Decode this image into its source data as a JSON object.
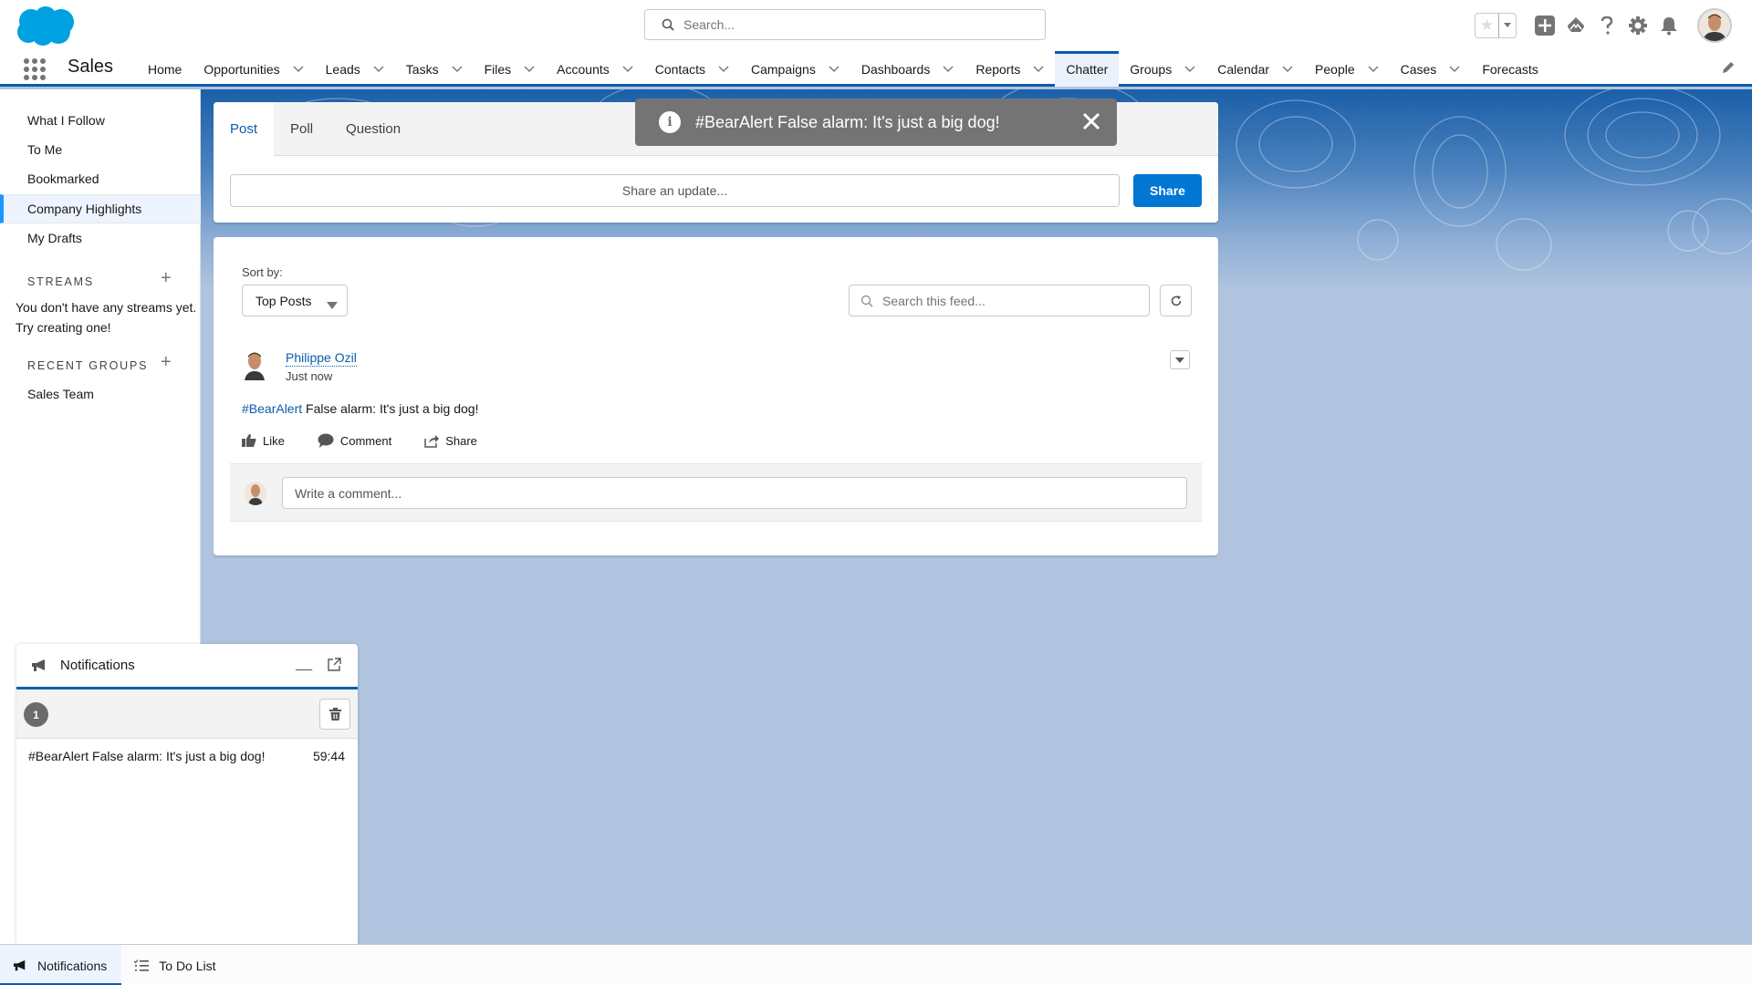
{
  "header": {
    "app_name": "Sales",
    "search_placeholder": "Search...",
    "icons": [
      "favorites-star-icon",
      "favorites-dropdown-icon",
      "global-actions-plus-icon",
      "trailhead-icon",
      "help-icon",
      "setup-gear-icon",
      "notifications-bell-icon",
      "user-avatar"
    ]
  },
  "nav": {
    "items": [
      {
        "label": "Home",
        "has_menu": false
      },
      {
        "label": "Opportunities",
        "has_menu": true
      },
      {
        "label": "Leads",
        "has_menu": true
      },
      {
        "label": "Tasks",
        "has_menu": true
      },
      {
        "label": "Files",
        "has_menu": true
      },
      {
        "label": "Accounts",
        "has_menu": true
      },
      {
        "label": "Contacts",
        "has_menu": true
      },
      {
        "label": "Campaigns",
        "has_menu": true
      },
      {
        "label": "Dashboards",
        "has_menu": true
      },
      {
        "label": "Reports",
        "has_menu": true
      },
      {
        "label": "Chatter",
        "has_menu": false,
        "active": true
      },
      {
        "label": "Groups",
        "has_menu": true
      },
      {
        "label": "Calendar",
        "has_menu": true
      },
      {
        "label": "People",
        "has_menu": true
      },
      {
        "label": "Cases",
        "has_menu": true
      },
      {
        "label": "Forecasts",
        "has_menu": false
      }
    ]
  },
  "sidebar": {
    "items": [
      {
        "label": "What I Follow"
      },
      {
        "label": "To Me"
      },
      {
        "label": "Bookmarked"
      },
      {
        "label": "Company Highlights",
        "active": true
      },
      {
        "label": "My Drafts"
      }
    ],
    "streams_heading": "STREAMS",
    "streams_empty": "You don't have any streams yet. Try creating one!",
    "groups_heading": "RECENT GROUPS",
    "groups": [
      {
        "label": "Sales Team"
      }
    ]
  },
  "publisher": {
    "tabs": [
      {
        "label": "Post",
        "active": true
      },
      {
        "label": "Poll"
      },
      {
        "label": "Question"
      }
    ],
    "input_placeholder": "Share an update...",
    "share_label": "Share"
  },
  "toast": {
    "message": "#BearAlert False alarm: It's just a big dog!",
    "icon": "info-icon"
  },
  "feed": {
    "sort_label": "Sort by:",
    "sort_value": "Top Posts",
    "search_placeholder": "Search this feed...",
    "post": {
      "author": "Philippe Ozil",
      "time": "Just now",
      "hashtag": "#BearAlert",
      "text": " False alarm: It's just a big dog!",
      "actions": {
        "like": "Like",
        "comment": "Comment",
        "share": "Share"
      },
      "comment_placeholder": "Write a comment..."
    }
  },
  "notifications_panel": {
    "title": "Notifications",
    "count": "1",
    "items": [
      {
        "message": "#BearAlert False alarm: It's just a big dog!",
        "time": "59:44"
      }
    ]
  },
  "utility_bar": {
    "items": [
      {
        "label": "Notifications",
        "active": true
      },
      {
        "label": "To Do List"
      }
    ]
  },
  "colors": {
    "brand_blue": "#0176d3",
    "nav_active_border": "#0b5cab",
    "link": "#0b5cab",
    "toast_bg": "#747474",
    "page_bg": "#b0c4df"
  }
}
